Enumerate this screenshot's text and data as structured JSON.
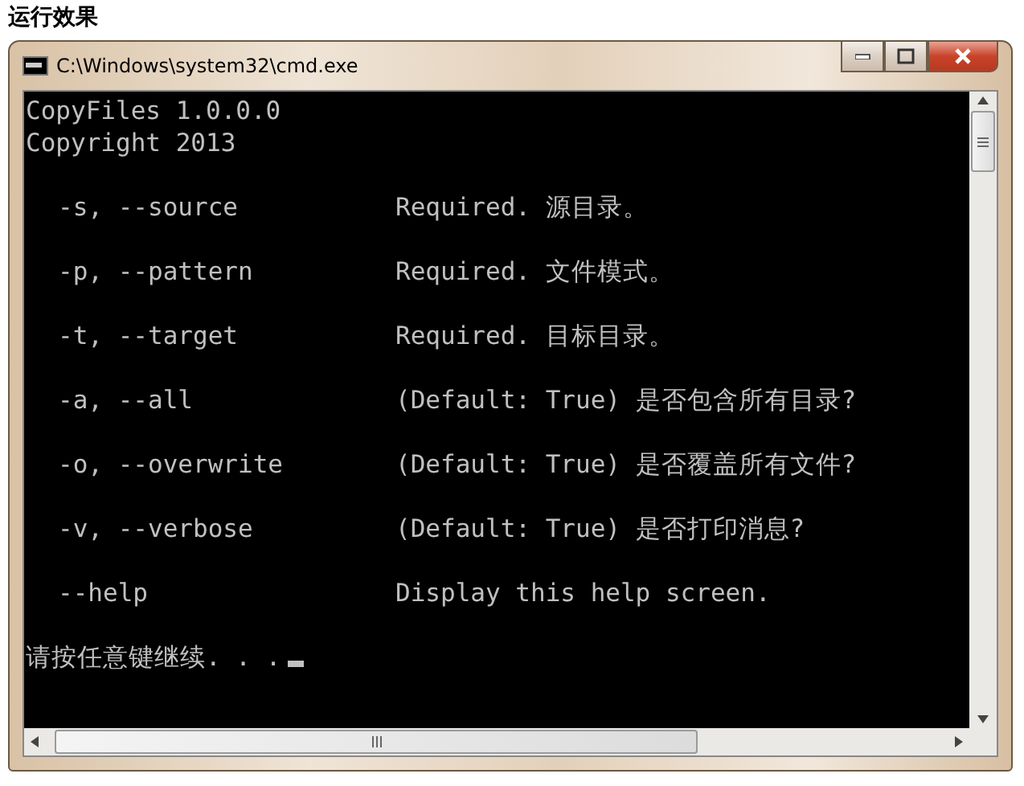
{
  "heading": "运行效果",
  "window": {
    "title": "C:\\Windows\\system32\\cmd.exe"
  },
  "console": {
    "header": [
      "CopyFiles 1.0.0.0",
      "Copyright 2013"
    ],
    "options": [
      {
        "flag": "-s, --source",
        "description": "Required. 源目录。"
      },
      {
        "flag": "-p, --pattern",
        "description": "Required. 文件模式。"
      },
      {
        "flag": "-t, --target",
        "description": "Required. 目标目录。"
      },
      {
        "flag": "-a, --all",
        "description": "(Default: True) 是否包含所有目录?"
      },
      {
        "flag": "-o, --overwrite",
        "description": "(Default: True) 是否覆盖所有文件?"
      },
      {
        "flag": "-v, --verbose",
        "description": "(Default: True) 是否打印消息?"
      },
      {
        "flag": "--help",
        "description": "Display this help screen."
      }
    ],
    "prompt": "请按任意键继续. . ."
  }
}
